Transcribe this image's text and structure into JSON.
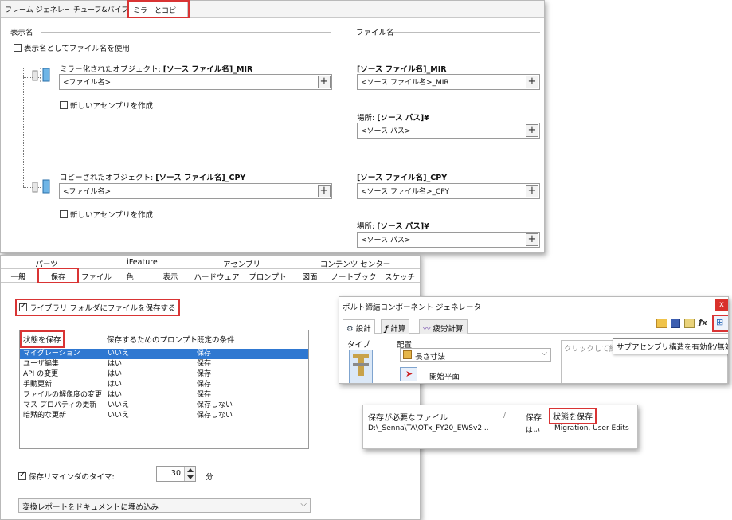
{
  "mirror_dialog": {
    "tabs": [
      "フレーム ジェネレータ",
      "チューブ&パイプ",
      "ミラーとコピー"
    ],
    "display_name_label": "表示名",
    "file_name_label": "ファイル名",
    "use_file_name_checkbox": "表示名としてファイル名を使用",
    "mirrored_object_label": "ミラー化されたオブジェクト:",
    "mirrored_object_value": "[ソース ファイル名]_MIR",
    "mirrored_field": "<ファイル名>",
    "mirror_new_assembly": "新しいアセンブリを作成",
    "mirror_file_label": "[ソース ファイル名]_MIR",
    "mirror_file_field": "<ソース ファイル名>_MIR",
    "mirror_location_label": "場所:",
    "mirror_location_value": "[ソース パス]¥",
    "mirror_location_field": "<ソース パス>",
    "copied_object_label": "コピーされたオブジェクト:",
    "copied_object_value": "[ソース ファイル名]_CPY",
    "copied_field": "<ファイル名>",
    "copy_new_assembly": "新しいアセンブリを作成",
    "copy_file_label": "[ソース ファイル名]_CPY",
    "copy_file_field": "<ソース ファイル名>_CPY",
    "copy_location_label": "場所:",
    "copy_location_value": "[ソース パス]¥",
    "copy_location_field": "<ソース パス>",
    "plus": "+"
  },
  "options_dialog": {
    "group_tabs": [
      "パーツ",
      "iFeature",
      "アセンブリ",
      "コンテンツ センター"
    ],
    "tabs": [
      "一般",
      "保存",
      "ファイル",
      "色",
      "表示",
      "ハードウェア",
      "プロンプト",
      "図面",
      "ノートブック",
      "スケッチ"
    ],
    "save_library_checkbox": "ライブラリ フォルダにファイルを保存する",
    "columns": [
      "状態を保存",
      "保存するためのプロンプト",
      "既定の条件"
    ],
    "rows": [
      [
        "マイグレーション",
        "いいえ",
        "保存"
      ],
      [
        "ユーザ編集",
        "はい",
        "保存"
      ],
      [
        "API の変更",
        "はい",
        "保存"
      ],
      [
        "手動更新",
        "はい",
        "保存"
      ],
      [
        "ファイルの解像度の変更",
        "はい",
        "保存"
      ],
      [
        "マス プロパティの更新",
        "いいえ",
        "保存しない"
      ],
      [
        "暗黙的な更新",
        "いいえ",
        "保存しない"
      ]
    ],
    "reminder_checkbox": "保存リマインダのタイマ:",
    "reminder_value": "30",
    "reminder_unit": "分",
    "dropdown_value": "変換レポートをドキュメントに埋め込み"
  },
  "bolt_dialog": {
    "title": "ボルト締結コンポーネント ジェネレータ",
    "close": "x",
    "tabs": [
      "設計",
      "計算",
      "疲労計算"
    ],
    "type_label": "タイプ",
    "placement_label": "配置",
    "placement_value": "長さ寸法",
    "start_plane": "開始平面",
    "hint_text": "クリックして締結を",
    "tooltip": "サブアセンブリ構造を有効化/無効化"
  },
  "save_list": {
    "header_file": "保存が必要なファイル",
    "header_save": "保存",
    "header_state": "状態を保存",
    "separator": "/",
    "file": "D:\\_Senna\\TA\\OTx_FY20_EWSv2...",
    "save": "はい",
    "state": "Migration, User Edits"
  },
  "colors": {
    "highlight_red": "#d93434",
    "selection_blue": "#2f78d1"
  }
}
